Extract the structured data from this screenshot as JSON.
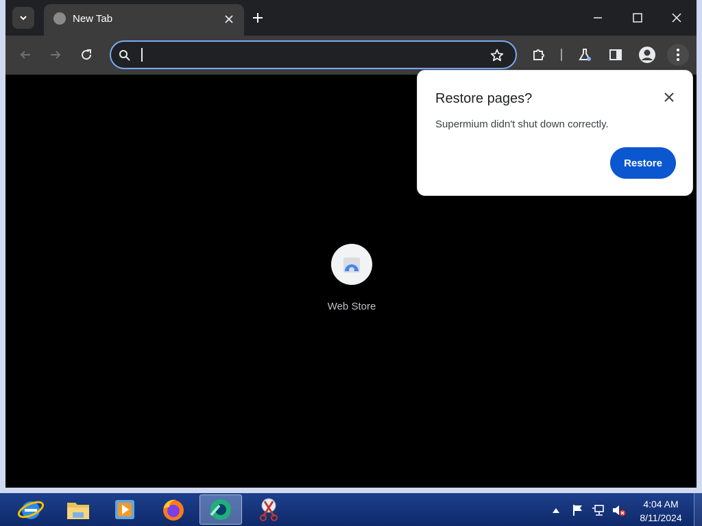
{
  "browser": {
    "tab": {
      "title": "New Tab"
    },
    "omnibox": {
      "value": "",
      "placeholder": ""
    }
  },
  "content": {
    "shortcuts": [
      {
        "label": "Web Store"
      }
    ]
  },
  "popup": {
    "title": "Restore pages?",
    "message": "Supermium didn't shut down correctly.",
    "button": "Restore"
  },
  "taskbar": {
    "apps": [
      "internet-explorer-icon",
      "file-explorer-icon",
      "media-player-icon",
      "firefox-icon",
      "supermium-icon",
      "snipping-tool-icon"
    ],
    "clock": {
      "time": "4:04 AM",
      "date": "8/11/2024"
    }
  },
  "colors": {
    "accent": "#0b57d0",
    "toolbar": "#3c3c3c",
    "tabstrip": "#202124",
    "omnibox_border": "#7baaf7"
  }
}
